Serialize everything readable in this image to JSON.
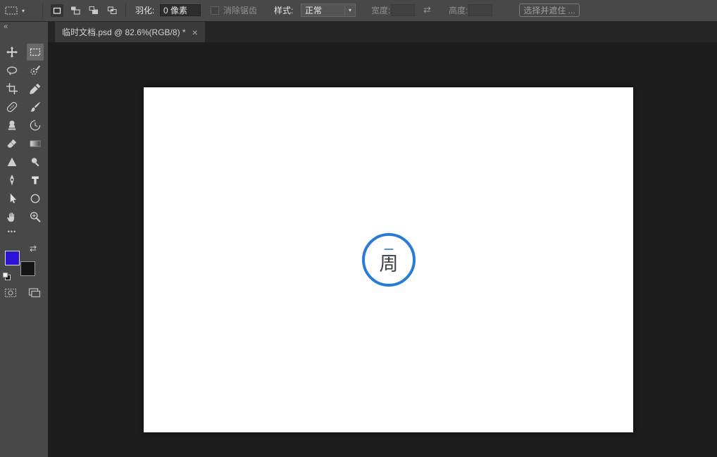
{
  "options_bar": {
    "preset_dropdown_glyph": "▾",
    "feather_label": "羽化:",
    "feather_value": "0 像素",
    "antialias_label": "消除锯齿",
    "style_label": "样式:",
    "style_value": "正常",
    "style_dropdown_glyph": "▾",
    "width_label": "宽度:",
    "width_value": "",
    "swap_dimensions_glyph": "⇄",
    "height_label": "高度:",
    "height_value": "",
    "select_and_mask_label": "选择并遮住 ..."
  },
  "document_tab": {
    "title": "临时文档.psd @ 82.6%(RGB/8) *",
    "close_glyph": "×"
  },
  "toolbar": {
    "collapse_glyph": "«",
    "more_glyph": "•••",
    "selected_tool": "rectangular-marquee",
    "tools": [
      "move",
      "rectangular-marquee",
      "lasso",
      "quick-selection",
      "crop",
      "eyedropper",
      "spot-healing",
      "brush",
      "clone-stamp",
      "history-brush",
      "eraser",
      "gradient",
      "sharpen",
      "dodge",
      "pen",
      "type",
      "path-selection",
      "ellipse",
      "hand",
      "zoom"
    ]
  },
  "color_swatches": {
    "foreground": "#2d13d6",
    "background": "#151515"
  },
  "canvas": {
    "logo_top_char": "一",
    "logo_bottom_char": "周",
    "ring_color": "#2b7ad6"
  }
}
